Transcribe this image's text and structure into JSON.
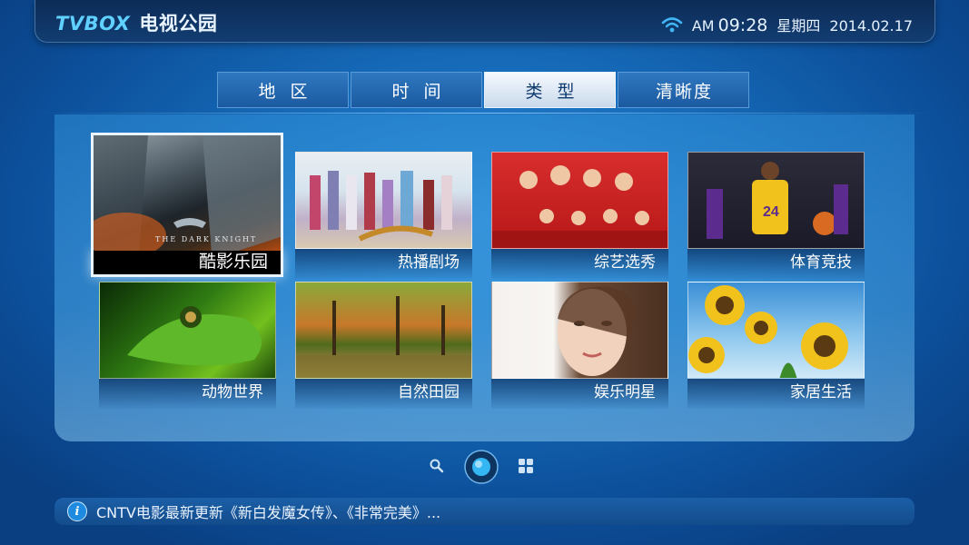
{
  "header": {
    "logo_en": "TVBOX",
    "logo_cn": "电视公园",
    "ampm": "AM",
    "time": "09:28",
    "weekday": "星期四",
    "date": "2014.02.17"
  },
  "tabs": [
    {
      "label": "地区"
    },
    {
      "label": "时间"
    },
    {
      "label": "类型",
      "active": true
    },
    {
      "label": "清晰度"
    }
  ],
  "tiles": [
    {
      "label": "酷影乐园",
      "focused": true,
      "thumb_text": "THE DARK KNIGHT"
    },
    {
      "label": "热播剧场"
    },
    {
      "label": "综艺选秀"
    },
    {
      "label": "体育竞技"
    },
    {
      "label": "动物世界"
    },
    {
      "label": "自然田园"
    },
    {
      "label": "娱乐明星"
    },
    {
      "label": "家居生活"
    }
  ],
  "dock": {
    "icons": [
      "search-icon",
      "home-orb-icon",
      "apps-grid-icon"
    ]
  },
  "ticker": {
    "text": "CNTV电影最新更新《新白发魔女传》、《非常完美》..."
  },
  "colors": {
    "accent": "#5fd0ff",
    "background": "#166bb9",
    "active_tab": "#f5f9ff"
  }
}
